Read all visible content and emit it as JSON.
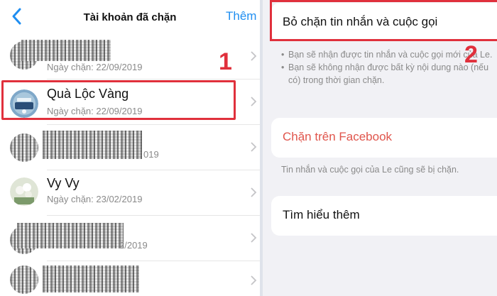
{
  "left": {
    "nav": {
      "title": "Tài khoản đã chặn",
      "action": "Thêm"
    },
    "items": [
      {
        "name": "",
        "date": "Ngày chặn: 22/09/2019",
        "obscured": true
      },
      {
        "name": "Quà Lộc Vàng",
        "date": "Ngày chặn: 22/09/2019",
        "obscured": false,
        "highlighted": true
      },
      {
        "name": "",
        "date": "019",
        "obscured": true
      },
      {
        "name": "Vy Vy",
        "date": "Ngày chặn: 23/02/2019",
        "obscured": false
      },
      {
        "name": "",
        "date": "2/2019",
        "obscured": true
      },
      {
        "name": "",
        "date": "",
        "obscured": true
      }
    ],
    "step_label": "1"
  },
  "right": {
    "unblock_label": "Bỏ chặn tin nhắn và cuộc gọi",
    "step_label": "2",
    "bullets": [
      "Bạn sẽ nhận được tin nhắn và cuộc gọi mới của Le.",
      "Bạn sẽ không nhận được bất kỳ nội dung nào (nếu có) trong thời gian chặn."
    ],
    "facebook_block_label": "Chặn trên Facebook",
    "facebook_note": "Tin nhắn và cuộc gọi của Le cũng sẽ bị chặn.",
    "learn_more_label": "Tìm hiểu thêm"
  },
  "colors": {
    "accent_blue": "#1f8ef1",
    "highlight_red": "#e0303c",
    "facebook_red": "#e0554c",
    "secondary_text": "#8a8a8a",
    "panel_bg": "#f1f1f5"
  },
  "icons": {
    "back": "chevron-left-icon",
    "row_chevron": "chevron-right-icon"
  }
}
